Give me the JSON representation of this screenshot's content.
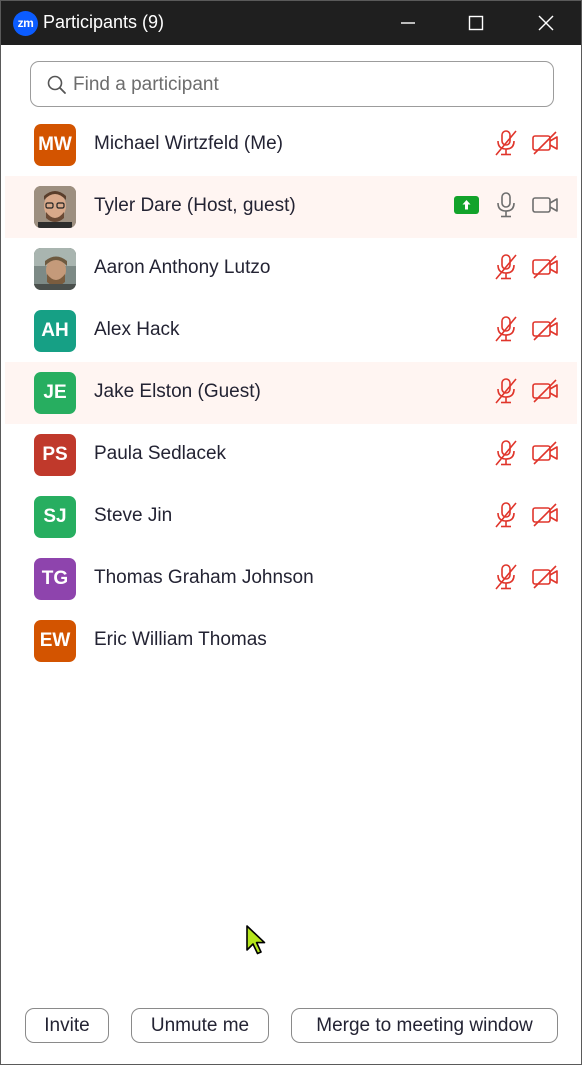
{
  "window": {
    "logo_text": "zm",
    "title": "Participants (9)"
  },
  "search": {
    "placeholder": "Find a participant",
    "value": ""
  },
  "participants": [
    {
      "initials": "MW",
      "name": "Michael Wirtzfeld (Me)",
      "avatar_color": "#d35400",
      "photo": false,
      "highlight": false,
      "sharing": false,
      "audio": "muted",
      "video": "off"
    },
    {
      "initials": "",
      "name": "Tyler Dare (Host, guest)",
      "avatar_color": "#8a7a6a",
      "photo": true,
      "highlight": true,
      "sharing": true,
      "audio": "on",
      "video": "on"
    },
    {
      "initials": "",
      "name": "Aaron Anthony Lutzo",
      "avatar_color": "#6a7a6a",
      "photo": true,
      "highlight": false,
      "sharing": false,
      "audio": "muted",
      "video": "off"
    },
    {
      "initials": "AH",
      "name": "Alex Hack",
      "avatar_color": "#16a085",
      "photo": false,
      "highlight": false,
      "sharing": false,
      "audio": "muted",
      "video": "off"
    },
    {
      "initials": "JE",
      "name": "Jake Elston (Guest)",
      "avatar_color": "#27ae60",
      "photo": false,
      "highlight": true,
      "sharing": false,
      "audio": "muted",
      "video": "off"
    },
    {
      "initials": "PS",
      "name": "Paula Sedlacek",
      "avatar_color": "#c0392b",
      "photo": false,
      "highlight": false,
      "sharing": false,
      "audio": "muted",
      "video": "off"
    },
    {
      "initials": "SJ",
      "name": "Steve Jin",
      "avatar_color": "#27ae60",
      "photo": false,
      "highlight": false,
      "sharing": false,
      "audio": "muted",
      "video": "off"
    },
    {
      "initials": "TG",
      "name": "Thomas Graham Johnson",
      "avatar_color": "#8e44ad",
      "photo": false,
      "highlight": false,
      "sharing": false,
      "audio": "muted",
      "video": "off"
    },
    {
      "initials": "EW",
      "name": "Eric William Thomas",
      "avatar_color": "#d35400",
      "photo": false,
      "highlight": false,
      "sharing": false,
      "audio": "none",
      "video": "none"
    }
  ],
  "buttons": {
    "invite": "Invite",
    "unmute": "Unmute me",
    "merge": "Merge to meeting window"
  },
  "colors": {
    "titlebar": "#1f1f1f",
    "muted_red": "#e0352b",
    "share_green": "#12a32b",
    "icon_gray": "#6e6e6e"
  }
}
